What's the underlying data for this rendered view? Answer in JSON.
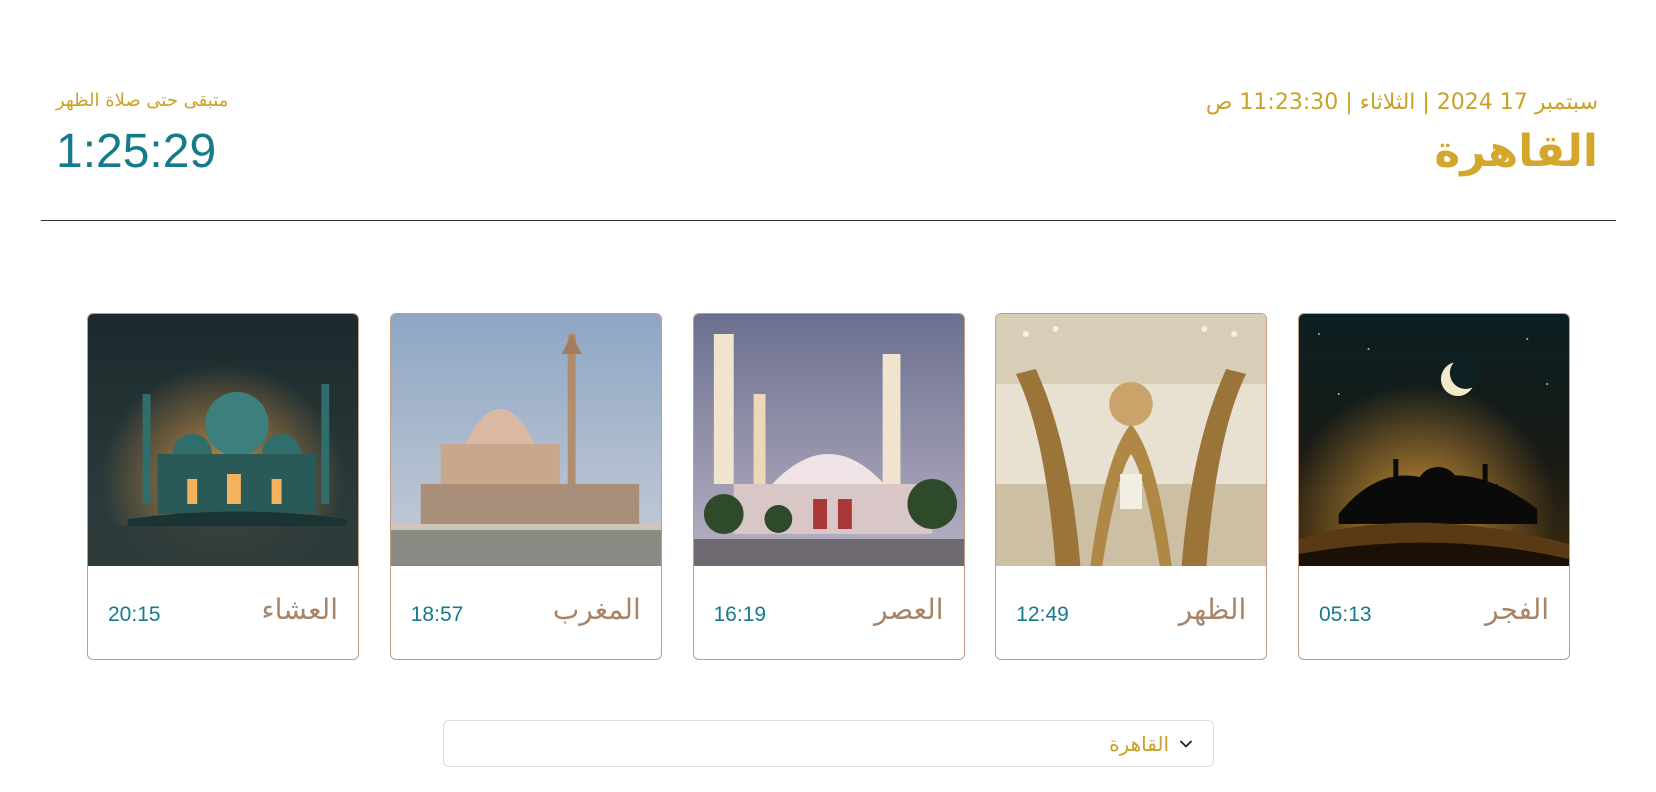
{
  "header": {
    "datetime": "سبتمبر 17 2024 | الثلاثاء | 11:23:30 ص",
    "city": "القاهرة",
    "remaining_label": "متبقى حتى صلاة الظهر",
    "countdown": "1:25:29"
  },
  "prayers": [
    {
      "name": "الفجر",
      "time": "05:13",
      "image": "crescent-night-mosque-image"
    },
    {
      "name": "الظهر",
      "time": "12:49",
      "image": "mosque-interior-image"
    },
    {
      "name": "العصر",
      "time": "16:19",
      "image": "mosque-minarets-dusk-image"
    },
    {
      "name": "المغرب",
      "time": "18:57",
      "image": "mosque-waterfront-image"
    },
    {
      "name": "العشاء",
      "time": "20:15",
      "image": "illuminated-mosque-image"
    }
  ],
  "city_select": {
    "value": "القاهرة",
    "icon": "chevron-down-icon"
  },
  "colors": {
    "gold": "#d4a72c",
    "teal": "#147a8c",
    "card_border": "#c49b86",
    "prayer_name": "#a88568"
  }
}
